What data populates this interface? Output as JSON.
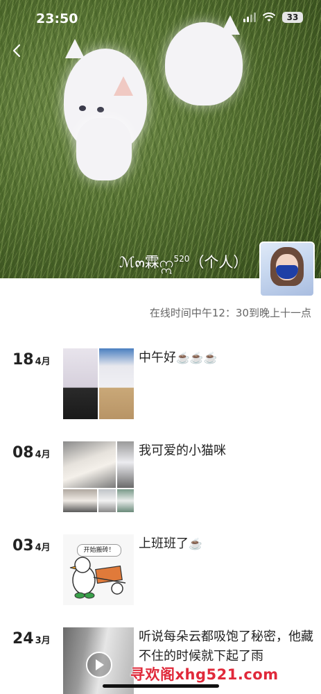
{
  "status_bar": {
    "time": "23:50",
    "battery": "33"
  },
  "profile": {
    "username": "ℳ๓霖ဣ",
    "username_sup": "520",
    "username_suffix": "（个人）",
    "online_hours": "在线时间中午12：30到晚上十一点"
  },
  "posts": [
    {
      "day": "18",
      "month": "4月",
      "caption": "中午好",
      "emoji": "☕️☕️☕️"
    },
    {
      "day": "08",
      "month": "4月",
      "caption": "我可爱的小猫咪",
      "emoji": ""
    },
    {
      "day": "03",
      "month": "4月",
      "caption": "上班班了",
      "emoji": "☕️",
      "thumb_text": "开始搬砖！"
    },
    {
      "day": "24",
      "month": "3月",
      "caption": "听说每朵云都吸饱了秘密，他藏不住的时候就下起了雨",
      "emoji": ""
    }
  ],
  "watermark": "寻欢阁xhg521.com",
  "icons": [
    "back-chevron-icon",
    "cellular-signal-icon",
    "wifi-icon",
    "battery-icon",
    "play-icon",
    "coffee-icon"
  ]
}
